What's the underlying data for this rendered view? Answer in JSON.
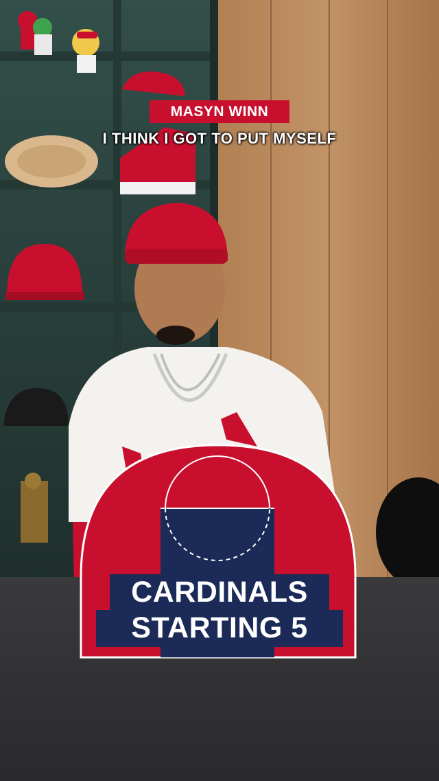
{
  "caption": {
    "speaker": "MASYN WINN",
    "quote": "I THINK I GOT TO PUT MYSELF"
  },
  "graphic": {
    "title_line1": "CARDINALS",
    "title_line2": "STARTING 5"
  },
  "colors": {
    "cardinal_red": "#c8102e",
    "navy": "#1b2a57",
    "wood": "#b8875b",
    "shelf": "#2f4a44",
    "table": "#2b2b2d"
  }
}
